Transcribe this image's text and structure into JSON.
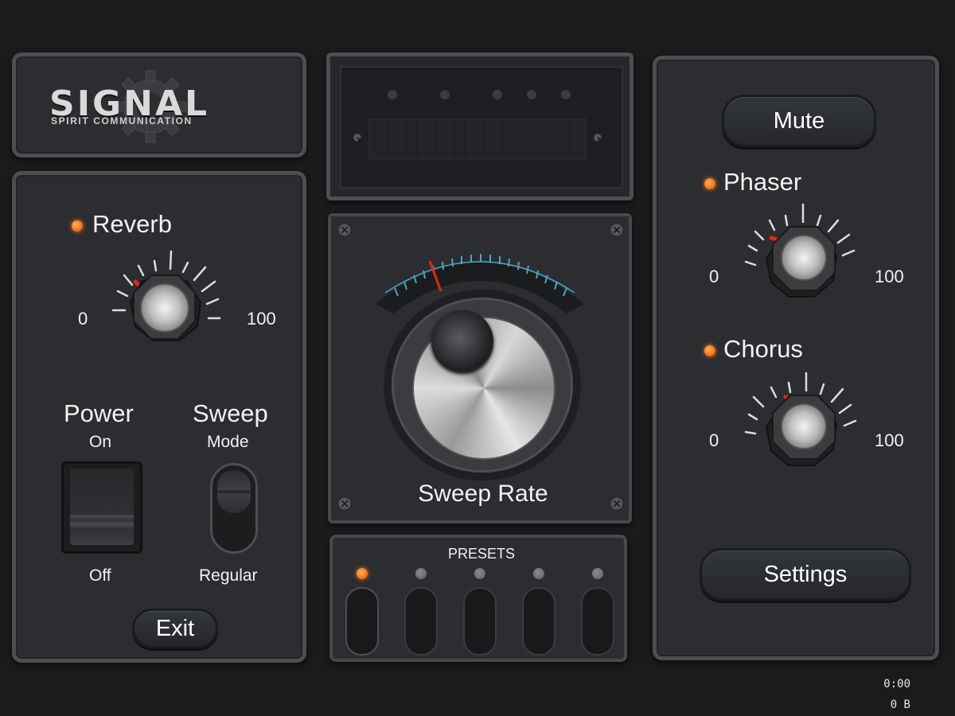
{
  "logo": {
    "title": "SIGNAL",
    "subtitle": "SPIRIT COMMUNICATION"
  },
  "reverb": {
    "label": "Reverb",
    "min": "0",
    "max": "100"
  },
  "power": {
    "title": "Power",
    "state_label": "On",
    "off_label": "Off"
  },
  "sweep": {
    "title": "Sweep",
    "subtitle": "Mode",
    "mode_label": "Regular"
  },
  "exit_label": "Exit",
  "sweep_rate": {
    "label": "Sweep Rate"
  },
  "presets": {
    "label": "PRESETS"
  },
  "mute_label": "Mute",
  "phaser": {
    "label": "Phaser",
    "min": "0",
    "max": "100"
  },
  "chorus": {
    "label": "Chorus",
    "min": "0",
    "max": "100"
  },
  "settings_label": "Settings",
  "status": {
    "time": "0:00",
    "bytes": "0 B"
  },
  "colors": {
    "accent": "#f5741a",
    "needle": "#e0261a",
    "scale": "#4fa3c8"
  }
}
